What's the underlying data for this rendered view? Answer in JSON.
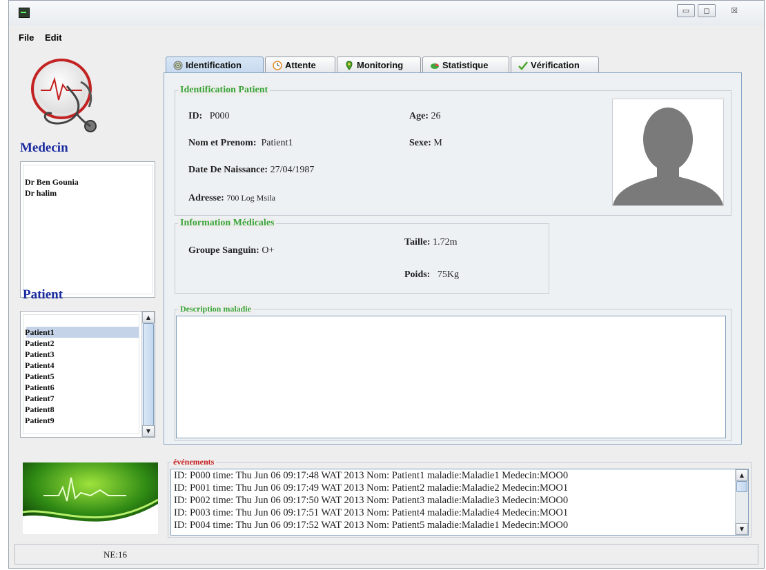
{
  "window": {
    "buttons": {
      "minimize": "▭",
      "maximize": "◻",
      "close": "☒"
    }
  },
  "menu": {
    "file": "File",
    "edit": "Edit"
  },
  "sidebar": {
    "medecin_heading": "Medecin",
    "medecins": [
      "Dr Ben Gounia",
      "Dr halim"
    ],
    "patient_heading": "Patient",
    "patients": [
      "Patient1",
      "Patient2",
      "Patient3",
      "Patient4",
      "Patient5",
      "Patient6",
      "Patient7",
      "Patient8",
      "Patient9"
    ],
    "selected_patient": "Patient1"
  },
  "tabs": [
    {
      "label": "Identification",
      "icon": "fingerprint-icon"
    },
    {
      "label": "Attente",
      "icon": "clock-icon"
    },
    {
      "label": "Monitoring",
      "icon": "map-pin-icon"
    },
    {
      "label": "Statistique",
      "icon": "pie-chart-icon"
    },
    {
      "label": "Vérification",
      "icon": "checkmark-icon"
    }
  ],
  "identification": {
    "legend": "Identification Patient",
    "id_label": "ID:",
    "id_value": "P000",
    "age_label": "Age:",
    "age_value": "26",
    "name_label": "Nom et Prenom:",
    "name_value": "Patient1",
    "sex_label": "Sexe:",
    "sex_value": "M",
    "dob_label": "Date De Naissance:",
    "dob_value": "27/04/1987",
    "address_label": "Adresse:",
    "address_value": "700 Log Msila"
  },
  "medical": {
    "legend": "Information Médicales",
    "blood_label": "Groupe Sanguin:",
    "blood_value": "O+",
    "height_label": "Taille:",
    "height_value": "1.72m",
    "weight_label": "Poids:",
    "weight_value": "75Kg"
  },
  "description": {
    "legend": "Description maladie",
    "value": ""
  },
  "events": {
    "legend": "événements",
    "lines": [
      "ID: P000 time: Thu Jun 06 09:17:48 WAT 2013 Nom: Patient1 maladie:Maladie1 Medecin:MOO0",
      "ID: P001 time: Thu Jun 06 09:17:49 WAT 2013 Nom: Patient2 maladie:Maladie2 Medecin:MOO1",
      "ID: P002 time: Thu Jun 06 09:17:50 WAT 2013 Nom: Patient3 maladie:Maladie3 Medecin:MOO0",
      "ID: P003 time: Thu Jun 06 09:17:51 WAT 2013 Nom: Patient4 maladie:Maladie4 Medecin:MOO1",
      "ID: P004 time: Thu Jun 06 09:17:52 WAT 2013 Nom: Patient5 maladie:Maladie1 Medecin:MOO0"
    ]
  },
  "status": {
    "text": "NE:16"
  },
  "colors": {
    "heading": "#1a2ba0",
    "legend_green": "#3aa53a",
    "legend_red": "#c81e1e",
    "selection": "#c5d3e8"
  }
}
